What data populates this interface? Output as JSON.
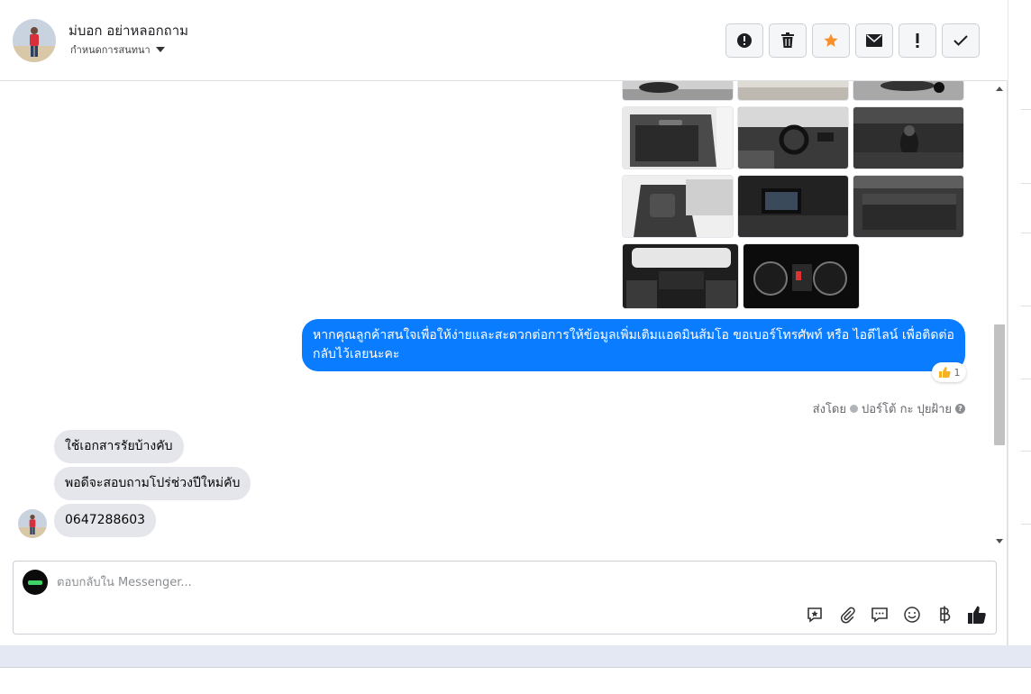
{
  "header": {
    "contact_name": "ม่บอก อย่าหลอกถาม",
    "assign_label": "กำหนดการสนทนา",
    "actions": [
      {
        "name": "mark-spam",
        "icon": "alert-circle-icon"
      },
      {
        "name": "delete",
        "icon": "trash-icon"
      },
      {
        "name": "star",
        "icon": "star-icon"
      },
      {
        "name": "mark-unread",
        "icon": "envelope-icon"
      },
      {
        "name": "follow-up",
        "icon": "exclamation-icon"
      },
      {
        "name": "mark-done",
        "icon": "checkmark-icon"
      }
    ]
  },
  "colors": {
    "outgoing_bubble": "#0a7cff",
    "incoming_bubble": "#e4e6eb",
    "star_accent": "#f5922f",
    "reaction_accent": "#f7b125"
  },
  "messages": {
    "outgoing_text": "หากคุณลูกค้าสนใจเพื่อให้ง่ายและสะดวกต่อการให้ข้อมูลเพิ่มเติมแอดมินส้มโอ ขอเบอร์โทรศัพท์ หรือ ไอดีไลน์ เพื่อติดต่อกลับไว้เลยนะคะ",
    "reaction_count": "1",
    "sent_by_label": "ส่งโดย",
    "sent_by_name": "ปอร์โต้ กะ ปุยฝ้าย",
    "incoming": [
      "ใช้เอกสารรัยบ้างคับ",
      "พอดีจะสอบถามโปร่ช่วงปีใหม่คับ",
      "0647288603"
    ]
  },
  "composer": {
    "placeholder": "ตอบกลับใน Messenger...",
    "tools": [
      "saved-reply-icon",
      "attachment-icon",
      "chat-bubble-icon",
      "emoji-icon",
      "baht-icon",
      "thumbs-up-icon"
    ]
  }
}
